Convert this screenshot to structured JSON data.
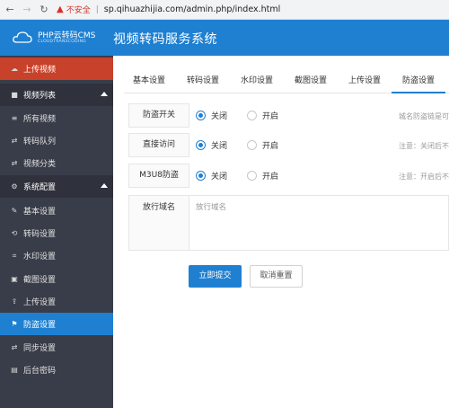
{
  "browser": {
    "back_icon": "arrow-left",
    "forward_icon": "arrow-right",
    "reload_icon": "reload",
    "security_label": "不安全",
    "url": "sp.qihuazhijia.com/admin.php/index.html"
  },
  "header": {
    "logo_title": "PHP云转码CMS",
    "logo_subtitle": "CLOUDTRANSCODING",
    "app_title": "视频转码服务系统",
    "color": "#1f80d1"
  },
  "sidebar": {
    "upload": "上传视频",
    "group_video": "视频列表",
    "items_video": [
      "所有视频",
      "转码队列",
      "视频分类"
    ],
    "group_config": "系统配置",
    "items_config": [
      "基本设置",
      "转码设置",
      "水印设置",
      "截图设置",
      "上传设置",
      "防盗设置",
      "同步设置",
      "后台密码"
    ]
  },
  "tabs": [
    "基本设置",
    "转码设置",
    "水印设置",
    "截图设置",
    "上传设置",
    "防盗设置"
  ],
  "active_tab": "防盗设置",
  "form": {
    "rows": [
      {
        "label": "防盗开关",
        "on": "关闭",
        "off": "开启",
        "hint": "城名防盗链是可"
      },
      {
        "label": "直接访问",
        "on": "关闭",
        "off": "开启",
        "hint": "注意：关闭后不"
      },
      {
        "label": "M3U8防盗",
        "on": "关闭",
        "off": "开启",
        "hint": "注意：开启后不"
      }
    ],
    "domain_label": "放行域名",
    "domain_placeholder": "放行域名",
    "submit": "立即提交",
    "reset": "取消重置"
  }
}
